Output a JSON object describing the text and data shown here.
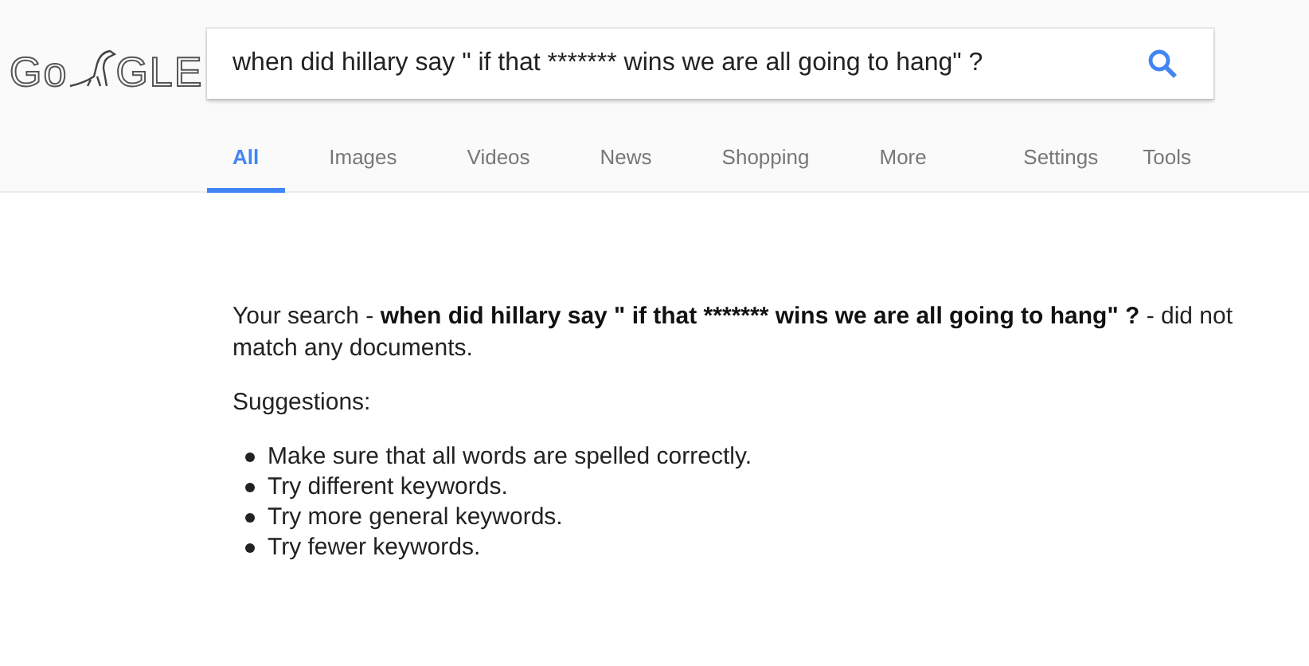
{
  "logo": {
    "left_text": "Go",
    "right_text": "GLE"
  },
  "search": {
    "value": "when did hillary say \" if that ******* wins we are all going to hang\" ?"
  },
  "tabs": [
    {
      "label": "All",
      "selected": true
    },
    {
      "label": "Images",
      "selected": false
    },
    {
      "label": "Videos",
      "selected": false
    },
    {
      "label": "News",
      "selected": false
    },
    {
      "label": "Shopping",
      "selected": false
    },
    {
      "label": "More",
      "selected": false
    }
  ],
  "tools": [
    "Settings",
    "Tools"
  ],
  "message": {
    "prefix": "Your search - ",
    "query": "when did hillary say \" if that ******* wins we are all going to hang\" ?",
    "suffix": "- did not match any documents."
  },
  "suggestions_title": "Suggestions:",
  "suggestions": [
    "Make sure that all words are spelled correctly.",
    "Try different keywords.",
    "Try more general keywords.",
    "Try fewer keywords."
  ]
}
